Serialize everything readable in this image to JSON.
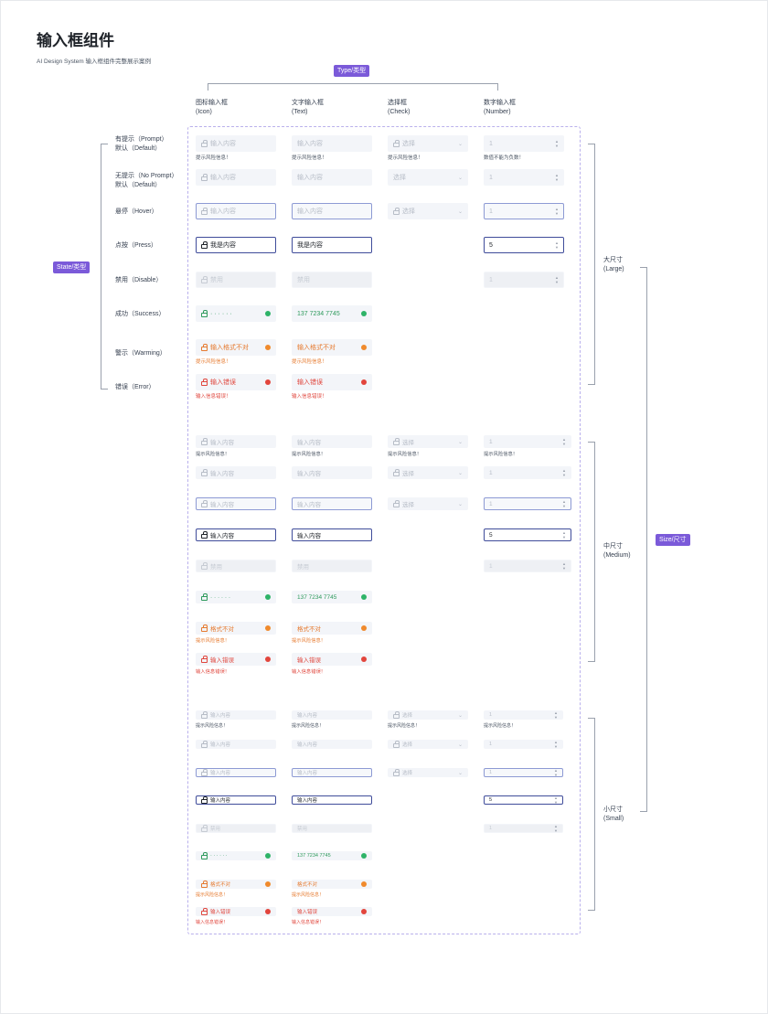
{
  "page": {
    "title": "输入框组件",
    "subtitle": "AI Design System 输入框组件完整展示案例"
  },
  "tags": {
    "type": "Type/类型",
    "state": "State/类型",
    "size": "Size/尺寸"
  },
  "columns": [
    {
      "line1": "图标输入框",
      "line2": "(Icon)"
    },
    {
      "line1": "文字输入框",
      "line2": "(Text)"
    },
    {
      "line1": "选择框",
      "line2": "(Check)"
    },
    {
      "line1": "数字输入框",
      "line2": "(Number)"
    }
  ],
  "states": [
    {
      "line1": "有提示（Prompt）",
      "line2": "默认（Default）"
    },
    {
      "line1": "无提示（No Prompt）",
      "line2": "默认（Default）"
    },
    {
      "line1": "悬停（Hover）",
      "line2": ""
    },
    {
      "line1": "点按（Press）",
      "line2": ""
    },
    {
      "line1": "禁用（Disable）",
      "line2": ""
    },
    {
      "line1": "成功（Success）",
      "line2": ""
    },
    {
      "line1": "警示（Warming）",
      "line2": ""
    },
    {
      "line1": "错误（Error）",
      "line2": ""
    }
  ],
  "sizes": [
    {
      "line1": "大尺寸",
      "line2": "(Large)"
    },
    {
      "line1": "中尺寸",
      "line2": "(Medium)"
    },
    {
      "line1": "小尺寸",
      "line2": "(Small)"
    }
  ],
  "text": {
    "placeholder": "输入内容",
    "select": "选择",
    "number_placeholder": "1",
    "pressed_icon": "我是内容",
    "pressed_icon_sm": "输入内容",
    "number_pressed": "5",
    "disabled": "禁用",
    "password": "· · · · · ·",
    "phone": "137 7234 7745",
    "warn_large": "输入格式不对",
    "warn_small": "格式不对",
    "error": "输入错误",
    "hint_prompt": "提示风险信息！",
    "hint_number": "数值不能为负数！",
    "hint_error": "输入信息错误！"
  }
}
